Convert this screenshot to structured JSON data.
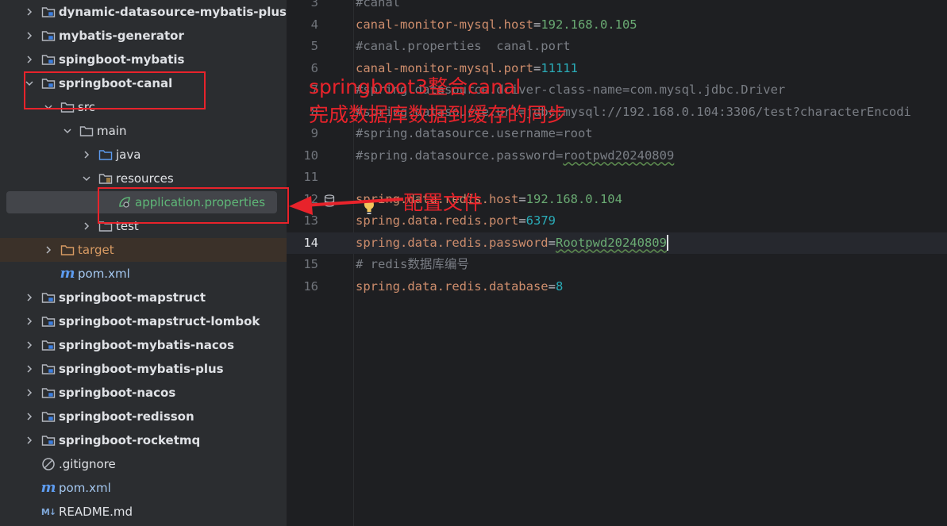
{
  "project_tree": {
    "items": [
      {
        "label": "dynamic-datasource-mybatis-plus",
        "type": "module",
        "expanded": false
      },
      {
        "label": "mybatis-generator",
        "type": "module",
        "expanded": false
      },
      {
        "label": "spingboot-mybatis",
        "type": "module",
        "expanded": false
      },
      {
        "label": "springboot-canal",
        "type": "module",
        "expanded": true
      },
      {
        "label": "src",
        "type": "folder",
        "expanded": true
      },
      {
        "label": "main",
        "type": "folder",
        "expanded": true
      },
      {
        "label": "java",
        "type": "source-folder",
        "expanded": false
      },
      {
        "label": "resources",
        "type": "resource-folder",
        "expanded": true
      },
      {
        "label": "application.properties",
        "type": "properties-file"
      },
      {
        "label": "test",
        "type": "folder",
        "expanded": false
      },
      {
        "label": "target",
        "type": "excluded-folder",
        "expanded": false
      },
      {
        "label": "pom.xml",
        "type": "maven-file"
      },
      {
        "label": "springboot-mapstruct",
        "type": "module",
        "expanded": false
      },
      {
        "label": "springboot-mapstruct-lombok",
        "type": "module",
        "expanded": false
      },
      {
        "label": "springboot-mybatis-nacos",
        "type": "module",
        "expanded": false
      },
      {
        "label": "springboot-mybatis-plus",
        "type": "module",
        "expanded": false
      },
      {
        "label": "springboot-nacos",
        "type": "module",
        "expanded": false
      },
      {
        "label": "springboot-redisson",
        "type": "module",
        "expanded": false
      },
      {
        "label": "springboot-rocketmq",
        "type": "module",
        "expanded": false
      },
      {
        "label": ".gitignore",
        "type": "ignore-file"
      },
      {
        "label": "pom.xml",
        "type": "maven-file"
      },
      {
        "label": "README.md",
        "type": "markdown-file"
      }
    ]
  },
  "editor": {
    "current_line": "14",
    "lines": [
      {
        "num": "3",
        "text": "#canal"
      },
      {
        "num": "4",
        "key": "canal-monitor-mysql.host",
        "value": "192.168.0.105"
      },
      {
        "num": "5",
        "text": "#canal.properties  canal.port"
      },
      {
        "num": "6",
        "key": "canal-monitor-mysql.port",
        "value": "11111"
      },
      {
        "num": "7",
        "text": "#spring.datasource.driver-class-name=com.mysql.jdbc.Driver"
      },
      {
        "num": "8",
        "text": "#spring.datasource.url=jdbc:mysql://192.168.0.104:3306/test?characterEncodi"
      },
      {
        "num": "9",
        "text": "#spring.datasource.username=root"
      },
      {
        "num": "10",
        "text_a": "#spring.datasource.password=",
        "text_b": "rootpwd20240809"
      },
      {
        "num": "11"
      },
      {
        "num": "12",
        "key": "spring.data.redis.host",
        "value": "192.168.0.104"
      },
      {
        "num": "13",
        "key": "spring.data.redis.port",
        "value": "6379"
      },
      {
        "num": "14",
        "key": "spring.data.redis.password",
        "value": "Rootpwd20240809"
      },
      {
        "num": "15",
        "text": "# redis数据库编号"
      },
      {
        "num": "16",
        "key": "spring.data.redis.database",
        "value": "8"
      }
    ]
  },
  "annotations": {
    "title_line1": "springboot3整合canal",
    "title_line2": "完成数据库数据到缓存的同步",
    "config_label": "配置文件"
  },
  "colors": {
    "annotation_red": "#e8232b",
    "property_key": "#cf8e6d",
    "property_value": "#6aab73",
    "number_value": "#2aacb8",
    "comment": "#7a7e85"
  }
}
